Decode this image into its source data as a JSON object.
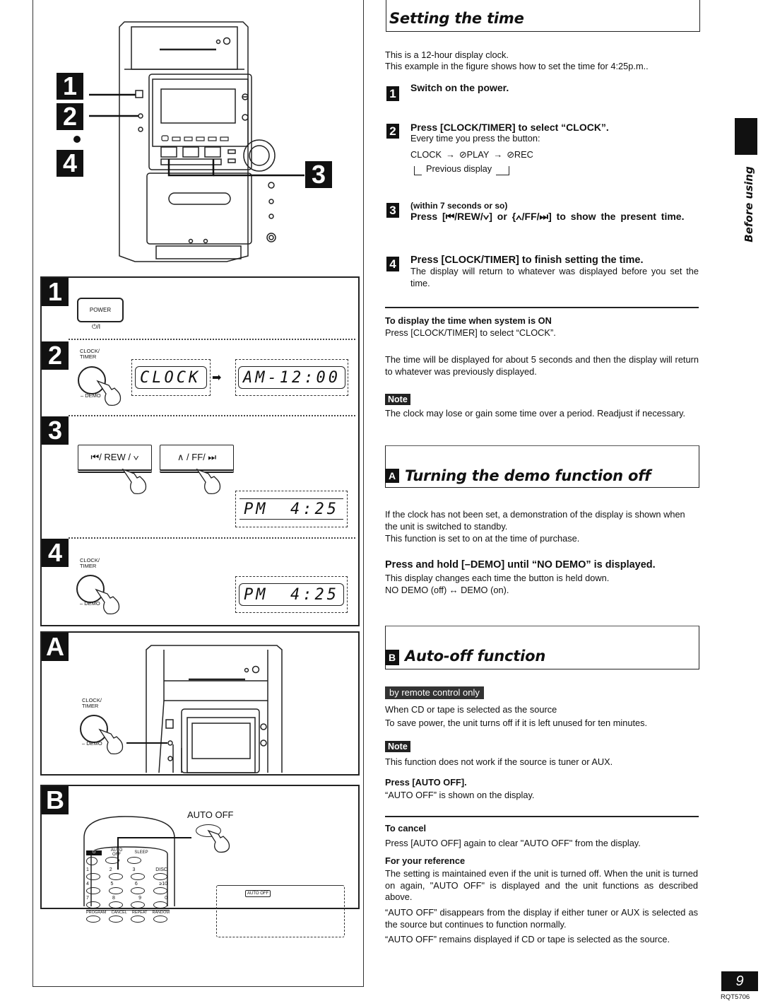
{
  "right": {
    "setting_time": {
      "title": "Setting the time",
      "intro_1": "This is a 12-hour display clock.",
      "intro_2": "This example in the figure shows how to set the time for 4:25p.m..",
      "steps": [
        {
          "num": "1",
          "heading": "Switch on the power."
        },
        {
          "num": "2",
          "heading": "Press [CLOCK/TIMER] to select “CLOCK”.",
          "text": "Every time you press the button:",
          "cycle": [
            "CLOCK",
            "⊘PLAY",
            "⊘REC"
          ],
          "cycle_return": "Previous display"
        },
        {
          "num": "3",
          "pre": "(within 7 seconds or so)",
          "heading": "Press [⏮/REW/∨] or {∧/FF/⏭] to show the present time."
        },
        {
          "num": "4",
          "heading": "Press [CLOCK/TIMER] to finish setting the time.",
          "text": "The display will return to whatever was displayed before you set the time."
        }
      ],
      "display_on_title": "To display the time when system is ON",
      "display_on_text": "Press [CLOCK/TIMER] to select “CLOCK”.",
      "display_duration": "The time will be displayed for about 5 seconds and then the display will return to whatever was previously displayed.",
      "note_label": "Note",
      "note_text": "The clock may lose or gain some time over a period. Readjust if necessary."
    },
    "demo_off": {
      "badge": "A",
      "title": "Turning the demo function off",
      "text_1": "If the clock has not been set, a demonstration of the display is shown when the unit is switched to standby.",
      "text_2": "This function is set to on at the time of purchase.",
      "heading": "Press and hold [–DEMO] until “NO DEMO” is displayed.",
      "text_3": "This display changes each time the button is held down.",
      "text_4": "NO DEMO (off) ↔ DEMO (on)."
    },
    "auto_off": {
      "badge": "B",
      "title": "Auto-off function",
      "remote_label": "by remote control only",
      "text_1": "When CD or tape is selected as the source",
      "text_2": "To save power, the unit turns off if it is left unused for ten minutes.",
      "note_label": "Note",
      "note_text": "This function does not work if the source is tuner or AUX.",
      "press_heading": "Press [AUTO OFF].",
      "press_text": "“AUTO OFF” is shown on the display.",
      "cancel_heading": "To cancel",
      "cancel_text": "Press [AUTO OFF] again to clear \"AUTO OFF\" from the display.",
      "ref_heading": "For your reference",
      "ref_text_1": "The setting is maintained even if the unit is turned off. When the unit is turned on again, \"AUTO OFF\" is displayed and the unit functions as described above.",
      "ref_text_2": "“AUTO OFF” disappears from the display if either tuner or AUX is selected as the source but continues to function normally.",
      "ref_text_3": "“AUTO OFF” remains displayed if CD or tape is selected as the source."
    }
  },
  "side_tab": {
    "label": "Before using"
  },
  "footer": {
    "page_number": "9",
    "doc_code": "RQT5706"
  },
  "left": {
    "overview": {
      "callouts": [
        "1",
        "2",
        "4",
        "3"
      ]
    },
    "panel_1": {
      "num": "1",
      "button": "POWER",
      "sub": "⏻/I"
    },
    "panel_2": {
      "num": "2",
      "button_label": "CLOCK/\nTIMER",
      "demo_label": "– DEMO",
      "lcd_1": "CLOCK",
      "lcd_2_left": "AM",
      "lcd_2_right": "-12:00"
    },
    "panel_3": {
      "num": "3",
      "btn_rew": "⏮/ REW / ∨",
      "btn_ff": "∧ / FF/ ⏭",
      "lcd_left": "PM",
      "lcd_right": "4:25"
    },
    "panel_4": {
      "num": "4",
      "button_label": "CLOCK/\nTIMER",
      "demo_label": "– DEMO",
      "lcd_left": "PM",
      "lcd_right": "4:25"
    },
    "panel_a": {
      "num": "A",
      "button_label": "CLOCK/\nTIMER",
      "demo_label": "– DEMO"
    },
    "panel_b": {
      "num": "B",
      "auto_off_label": "AUTO OFF",
      "remote_row_1": [
        "⏻",
        "AUTO OFF",
        "SLEEP"
      ],
      "remote_row_2": [
        "1",
        "2",
        "3",
        "DISC"
      ],
      "remote_row_3": [
        "4",
        "5",
        "6",
        "≥10"
      ],
      "remote_row_4": [
        "7",
        "8",
        "9",
        "0"
      ],
      "remote_row_5": [
        "PROGRAM",
        "CANCEL",
        "REPEAT",
        "RANDOM"
      ],
      "display_indicator": "AUTO OFF"
    }
  }
}
